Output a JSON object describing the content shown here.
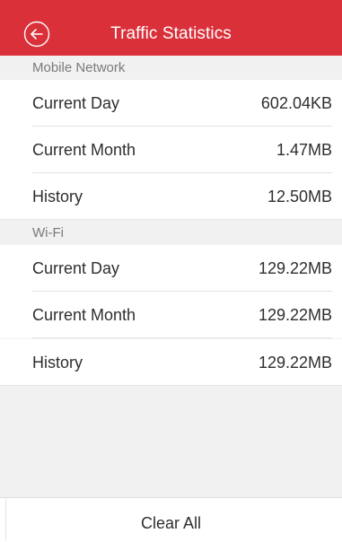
{
  "header": {
    "title": "Traffic Statistics",
    "back_icon": "back-arrow-circle-icon",
    "color": "#d9303a"
  },
  "mobile_network": {
    "title": "Mobile Network",
    "rows": [
      {
        "label": "Current Day",
        "value": "602.04KB"
      },
      {
        "label": "Current Month",
        "value": "1.47MB"
      },
      {
        "label": "History",
        "value": "12.50MB"
      }
    ]
  },
  "wifi": {
    "title": "Wi-Fi",
    "rows": [
      {
        "label": "Current Day",
        "value": "129.22MB"
      },
      {
        "label": "Current Month",
        "value": "129.22MB"
      },
      {
        "label": "History",
        "value": "129.22MB"
      }
    ]
  },
  "footer": {
    "clear_label": "Clear All"
  }
}
